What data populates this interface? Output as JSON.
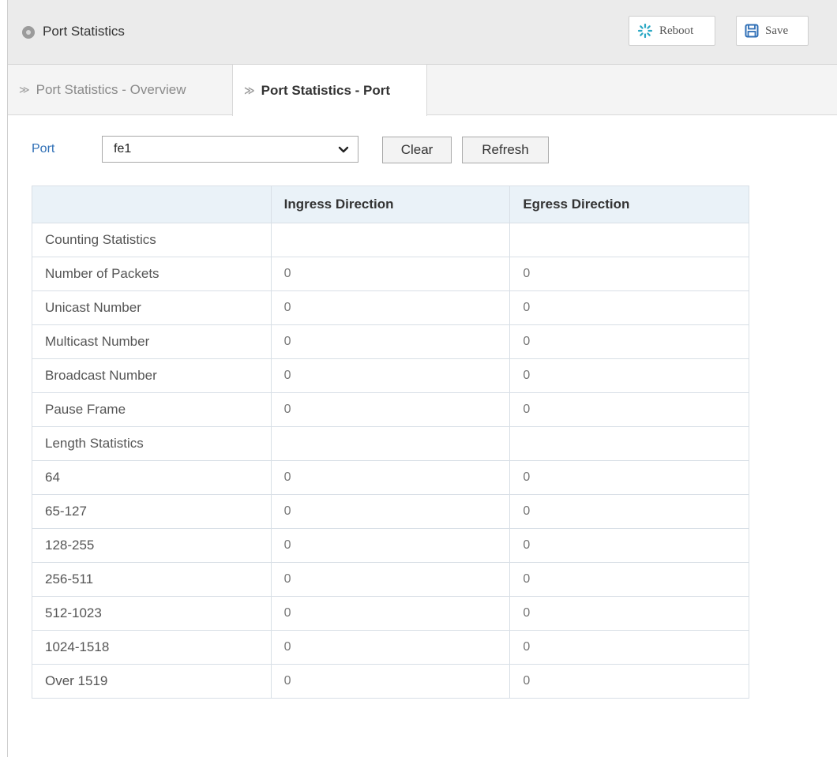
{
  "header": {
    "title": "Port Statistics",
    "reboot_label": "Reboot",
    "save_label": "Save"
  },
  "tabs": [
    {
      "label": "Port Statistics - Overview",
      "active": false
    },
    {
      "label": "Port Statistics - Port",
      "active": true
    }
  ],
  "controls": {
    "port_label": "Port",
    "port_value": "fe1",
    "clear_label": "Clear",
    "refresh_label": "Refresh"
  },
  "table": {
    "columns": [
      "",
      "Ingress Direction",
      "Egress Direction"
    ],
    "rows": [
      [
        "Counting Statistics",
        "",
        ""
      ],
      [
        "Number of Packets",
        "0",
        "0"
      ],
      [
        "Unicast Number",
        "0",
        "0"
      ],
      [
        "Multicast Number",
        "0",
        "0"
      ],
      [
        "Broadcast Number",
        "0",
        "0"
      ],
      [
        "Pause Frame",
        "0",
        "0"
      ],
      [
        "Length Statistics",
        "",
        ""
      ],
      [
        "64",
        "0",
        "0"
      ],
      [
        "65-127",
        "0",
        "0"
      ],
      [
        "128-255",
        "0",
        "0"
      ],
      [
        "256-511",
        "0",
        "0"
      ],
      [
        "512-1023",
        "0",
        "0"
      ],
      [
        "1024-1518",
        "0",
        "0"
      ],
      [
        "Over 1519",
        "0",
        "0"
      ]
    ]
  },
  "colors": {
    "header_bg": "#ebebeb",
    "table_header_bg": "#eaf2f8",
    "link_blue": "#2f6fb6",
    "reboot_icon": "#2aa8c4",
    "save_icon": "#2f6fb6"
  },
  "icons": {
    "header": "circle-icon",
    "reboot": "spinner-icon",
    "save": "floppy-disk-icon",
    "tab": "chevron-right-icon",
    "select": "chevron-down-icon"
  }
}
